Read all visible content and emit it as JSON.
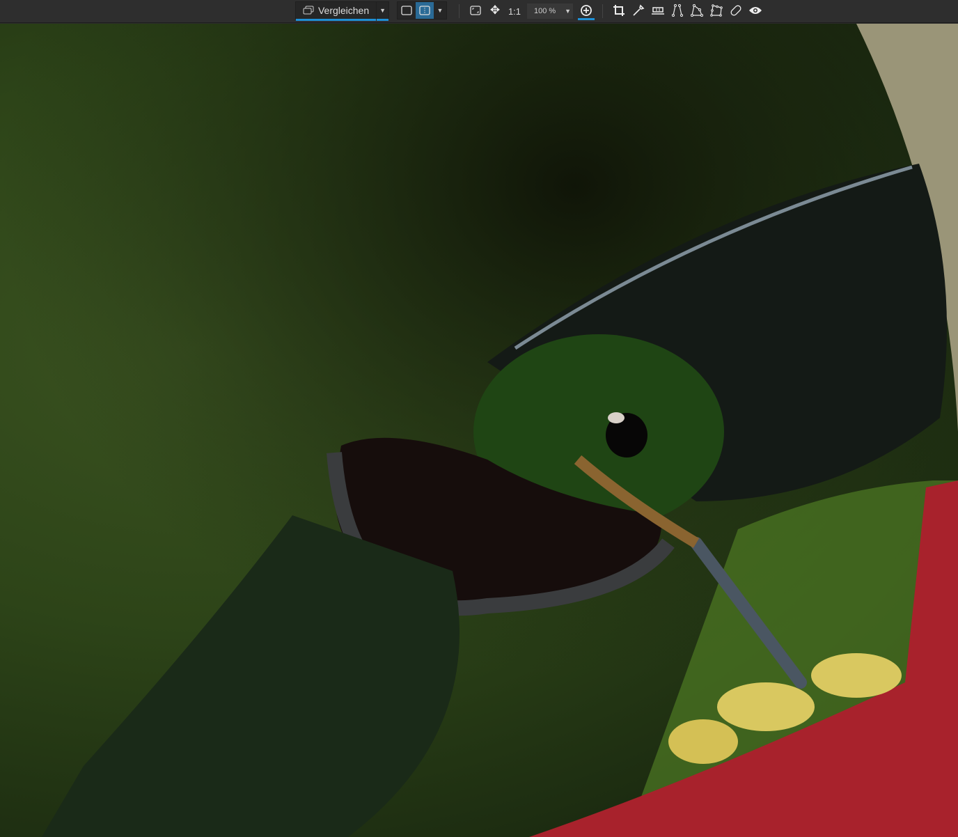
{
  "toolbar": {
    "compare_label": "Vergleichen",
    "one_to_one_label": "1:1",
    "zoom_value": "100 %",
    "icons": [
      "compare-icon",
      "single-view-icon",
      "split-view-icon",
      "fit-screen-icon",
      "move-icon",
      "zoom-in-icon",
      "crop-icon",
      "eyedropper-icon",
      "horizon-icon",
      "vertical-perspective-icon",
      "perspective-4-icon",
      "perspective-8-icon",
      "repair-icon",
      "eye-icon"
    ],
    "accent": "#1e90d6"
  }
}
